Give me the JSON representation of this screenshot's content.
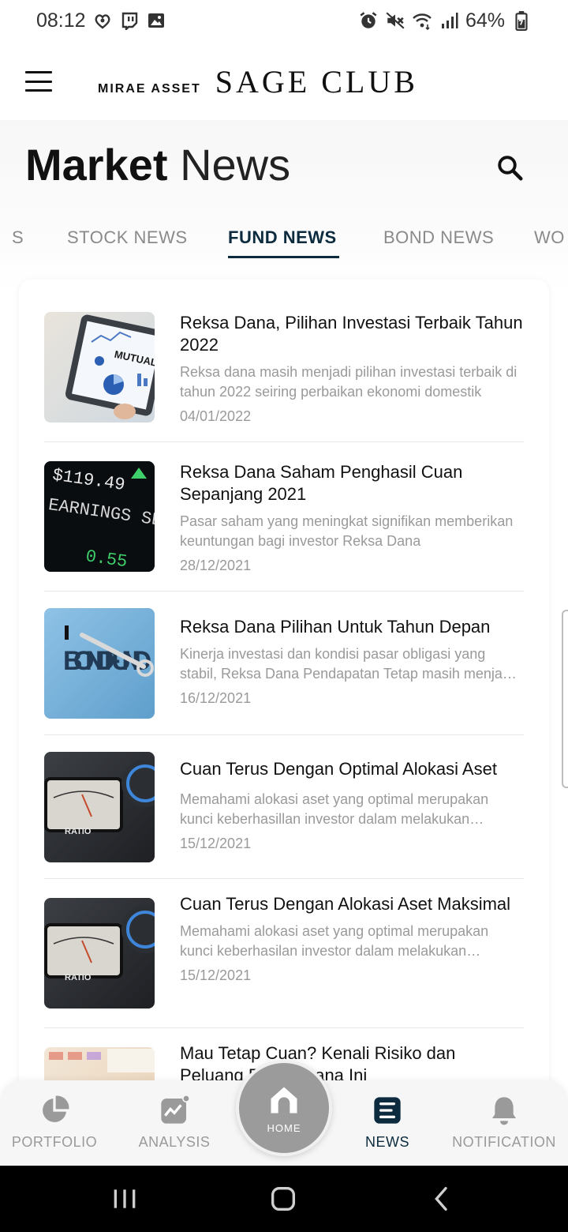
{
  "status_bar": {
    "time": "08:12",
    "battery": "64%"
  },
  "header": {
    "brand_small": "MIRAE ASSET",
    "brand_large": "SAGE CLUB"
  },
  "page": {
    "title_bold": "Market",
    "title_light": "News"
  },
  "tabs": [
    {
      "label": "S"
    },
    {
      "label": "STOCK NEWS"
    },
    {
      "label": "FUND NEWS",
      "active": true
    },
    {
      "label": "BOND NEWS"
    },
    {
      "label": "WO"
    }
  ],
  "news": [
    {
      "title": "Reksa Dana, Pilihan Investasi Terbaik Tahun 2022",
      "summary": "Reksa dana masih menjadi pilihan investasi terbaik di tahun 2022 seiring perbaikan ekonomi domestik",
      "date": "04/01/2022",
      "thumb_text": "MUTUAL FUNDS"
    },
    {
      "title": "Reksa Dana Saham Penghasil Cuan Sepanjang 2021",
      "summary": "Pasar saham yang meningkat signifikan memberikan keuntungan bagi investor Reksa Dana",
      "date": "28/12/2021",
      "thumb_text": "EARNINGS SEASON",
      "thumb_number": "$119.49"
    },
    {
      "title": "Reksa Dana Pilihan Untuk Tahun Depan",
      "summary": "Kinerja investasi dan kondisi pasar obligasi yang stabil, Reksa Dana Pendapatan Tetap masih menjadi pilihan",
      "date": "16/12/2021",
      "thumb_text": "BOND FUND"
    },
    {
      "title": "Cuan Terus Dengan Optimal Alokasi Aset",
      "summary": "Memahami alokasi aset  yang optimal merupakan kunci keberhasillan investor dalam melakukan investasi",
      "date": "15/12/2021",
      "thumb_text": "RATIO"
    },
    {
      "title": "Cuan Terus Dengan Alokasi Aset Maksimal",
      "summary": "Memahami alokasi aset yang optimal merupakan kunci keberhasilan investor dalam melakukan investasi",
      "date": "15/12/2021",
      "thumb_text": "RATIO"
    },
    {
      "title": "Mau Tetap Cuan? Kenali Risiko dan Peluang Reksa Dana Ini",
      "summary": "",
      "date": ""
    }
  ],
  "bottom_nav": {
    "portfolio": "PORTFOLIO",
    "analysis": "ANALYSIS",
    "home": "HOME",
    "news": "NEWS",
    "notification": "NOTIFICATION"
  },
  "colors": {
    "accent": "#0d2b3e",
    "muted": "#9a9a9a",
    "home_button": "#9b9b9b"
  }
}
